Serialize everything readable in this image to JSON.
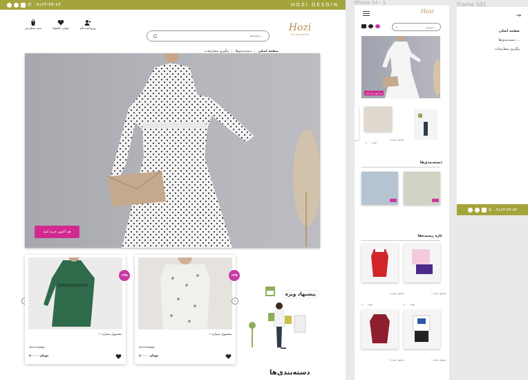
{
  "topbar": {
    "phone": "۰۹۱۲۳-۳۴-۶۳",
    "brand": "HOZI DESGIN",
    "socials": [
      "whatsapp-icon",
      "telegram-icon",
      "instagram-icon",
      "phone-icon"
    ]
  },
  "header": {
    "login_label": "ورود/ثبت‌نام",
    "favorites_label": "موارد دلخواه",
    "cart_label": "سبد سفارش",
    "search_placeholder": "جستجو...",
    "logo_tag": "You are perfect",
    "logo_mark": "Hozi"
  },
  "nav": {
    "items": [
      "صفحه اصلی",
      "دسته‌بندی‌ها",
      "پیگیری سفارشات"
    ]
  },
  "hero": {
    "button_label": "هم اکنون خرید کنید"
  },
  "products": [
    {
      "title": "محصول شماره ۱",
      "old_price": "۱۲۰۰۰۰ تومان",
      "new_price": "۸۰۰۰۰ تومان",
      "badge": "٪۲۵"
    },
    {
      "title": "محصول شماره ۱",
      "old_price": "۱۲۰۰۰۰ تومان",
      "new_price": "۸۰۰۰۰ تومان",
      "badge": "٪۲۵"
    }
  ],
  "special": {
    "label": "پیشنهاد ویژه"
  },
  "sections": {
    "categories": "دسته‌بندی‌ها",
    "new_arrivals": "تازه رسیده‌ها"
  },
  "mobile": {
    "caption": "iPhone 14 - 1",
    "search_placeholder": "جستجو...",
    "hero_button": "هم اکنون خرید کنید",
    "products": [
      {
        "title": "محصول شماره ۱",
        "price": "۸۰۰۰۰ تومان"
      },
      {
        "title": "محصول شماره ۱",
        "price": "۸۰۰۰۰ تومان"
      }
    ]
  },
  "frame": {
    "caption": "Frame 101",
    "back": "→",
    "items": [
      "صفحه اصلی",
      "دسته‌بندی‌ها ...",
      "پیگیری سفارشات"
    ],
    "phone": "۰۹۱۲۳-۳۴-۶۳"
  },
  "colors": {
    "olive": "#a4a43c",
    "pink": "#d02a91",
    "badge": "#c939a2"
  }
}
